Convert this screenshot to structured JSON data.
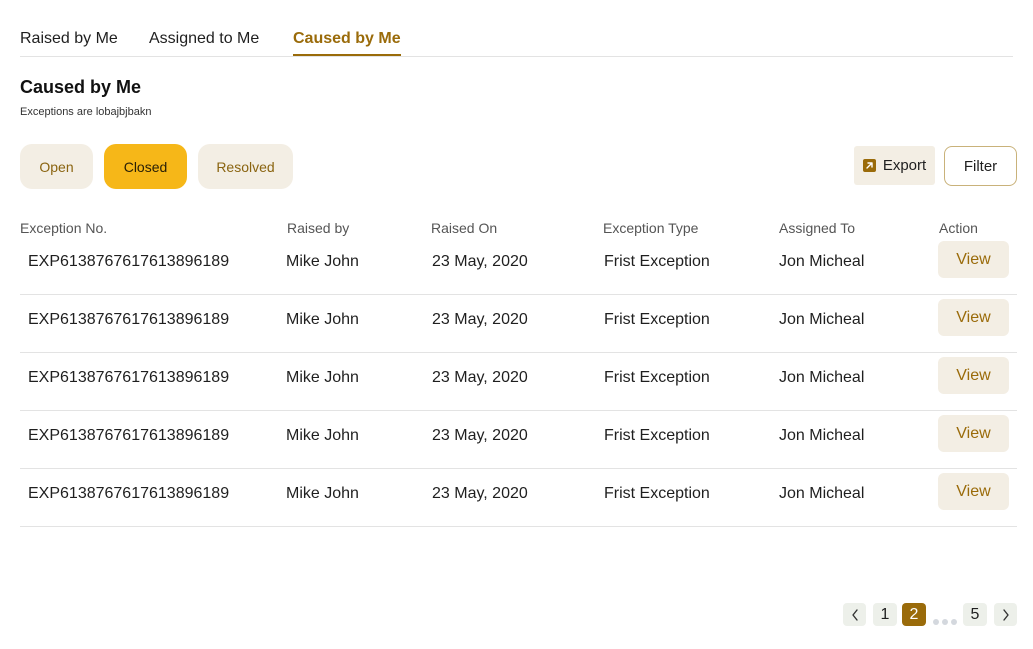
{
  "tabs": [
    {
      "label": "Raised by Me",
      "active": false
    },
    {
      "label": "Assigned to Me",
      "active": false
    },
    {
      "label": "Caused by Me",
      "active": true
    }
  ],
  "header": {
    "title": "Caused by Me",
    "subtitle": "Exceptions are lobajbjbakn"
  },
  "status_filters": [
    {
      "label": "Open",
      "active": false
    },
    {
      "label": "Closed",
      "active": true
    },
    {
      "label": "Resolved",
      "active": false
    }
  ],
  "toolbar": {
    "export_label": "Export",
    "export_icon": "arrow-up-right-icon",
    "filter_label": "Filter"
  },
  "table": {
    "columns": [
      "Exception No.",
      "Raised by",
      "Raised On",
      "Exception Type",
      "Assigned To",
      "Action"
    ],
    "rows": [
      {
        "exception_no": "EXP6138767617613896189",
        "raised_by": "Mike John",
        "raised_on": "23 May, 2020",
        "exception_type": "Frist Exception",
        "assigned_to": "Jon Micheal",
        "action": "View"
      },
      {
        "exception_no": "EXP6138767617613896189",
        "raised_by": "Mike John",
        "raised_on": "23 May, 2020",
        "exception_type": "Frist Exception",
        "assigned_to": "Jon Micheal",
        "action": "View"
      },
      {
        "exception_no": "EXP6138767617613896189",
        "raised_by": "Mike John",
        "raised_on": "23 May, 2020",
        "exception_type": "Frist Exception",
        "assigned_to": "Jon Micheal",
        "action": "View"
      },
      {
        "exception_no": "EXP6138767617613896189",
        "raised_by": "Mike John",
        "raised_on": "23 May, 2020",
        "exception_type": "Frist Exception",
        "assigned_to": "Jon Micheal",
        "action": "View"
      },
      {
        "exception_no": "EXP6138767617613896189",
        "raised_by": "Mike John",
        "raised_on": "23 May, 2020",
        "exception_type": "Frist Exception",
        "assigned_to": "Jon Micheal",
        "action": "View"
      }
    ]
  },
  "pagination": {
    "pages": [
      "1",
      "2",
      "5"
    ],
    "current": "2",
    "prev_icon": "chevron-left-icon",
    "next_icon": "chevron-right-icon"
  },
  "colors": {
    "accent": "#9a6b0a",
    "active_chip": "#f6b718",
    "chip_bg": "#f3eee4"
  }
}
